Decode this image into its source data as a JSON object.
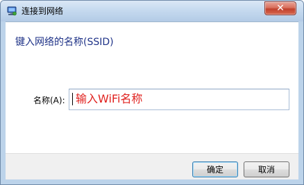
{
  "window": {
    "title": "连接到网络",
    "close_symbol": "✕",
    "icon": "network-connect-icon"
  },
  "main": {
    "heading": "键入网络的名称(SSID)",
    "field_label": "名称(A):",
    "field_value": "输入WiFi名称"
  },
  "buttons": {
    "ok_label": "确定",
    "cancel_label": "取消"
  },
  "colors": {
    "heading": "#1e3287",
    "input_text": "#e0221f",
    "close_button": "#c1412d",
    "title_bar": "#c6daef"
  }
}
